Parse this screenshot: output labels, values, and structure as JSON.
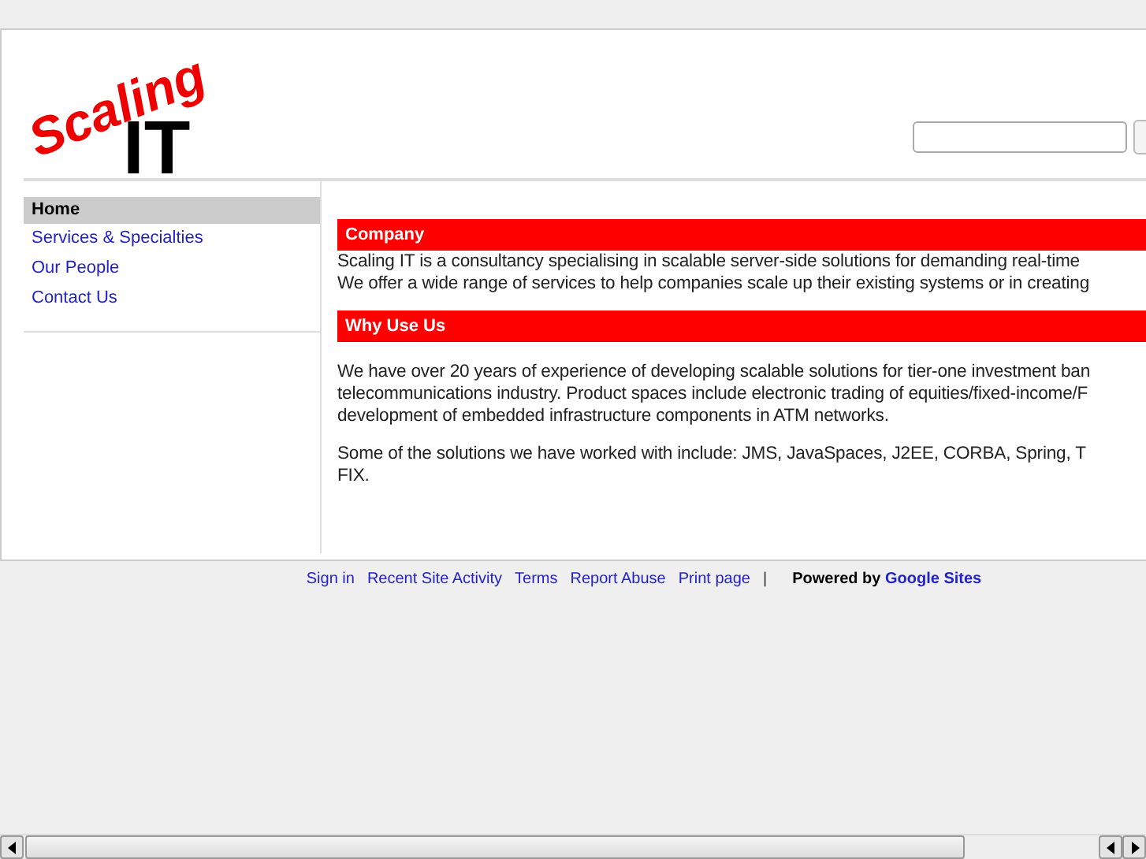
{
  "logo": {
    "word": "Scaling",
    "mark": "IT"
  },
  "sidebar": {
    "items": [
      {
        "label": "Home",
        "selected": true
      },
      {
        "label": "Services & Specialties",
        "selected": false
      },
      {
        "label": "Our People",
        "selected": false
      },
      {
        "label": "Contact Us",
        "selected": false
      }
    ]
  },
  "sections": [
    {
      "heading": "Company",
      "paragraphs": [
        [
          "Scaling IT is a consultancy specialising in scalable server-side solutions for demanding real-time",
          "We offer a wide range of services to help companies scale up their existing systems or in creating"
        ]
      ]
    },
    {
      "heading": "Why Use Us",
      "paragraphs": [
        [
          "We have over 20 years of experience of developing scalable solutions for tier-one investment ban",
          "telecommunications industry. Product spaces include electronic trading of equities/fixed-income/F",
          "development of embedded infrastructure components in ATM networks."
        ],
        [
          "Some of the solutions we have worked with include: JMS, JavaSpaces, J2EE, CORBA, Spring, T",
          "FIX."
        ]
      ]
    }
  ],
  "footer": {
    "links": [
      "Sign in",
      "Recent Site Activity",
      "Terms",
      "Report Abuse",
      "Print page"
    ],
    "separator": "|",
    "powered_by": "Powered by",
    "brand": "Google Sites"
  }
}
